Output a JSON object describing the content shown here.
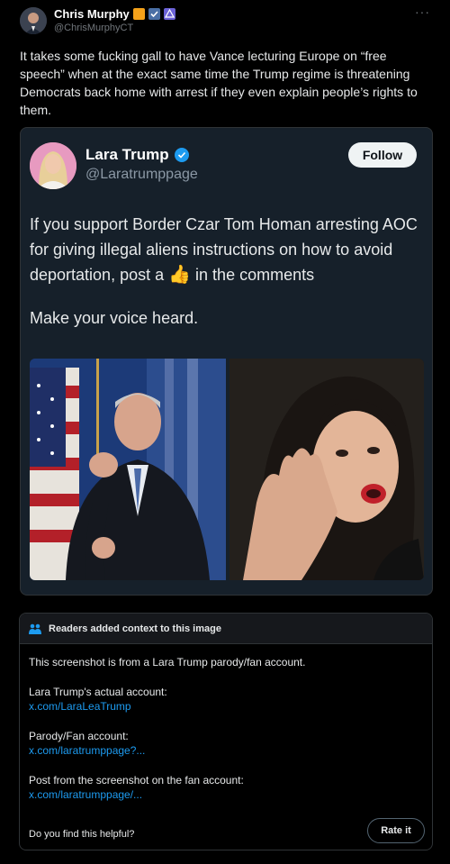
{
  "author": {
    "name": "Chris Murphy",
    "handle": "@ChrisMurphyCT"
  },
  "more_label": "···",
  "tweet_text": "It takes some fucking gall to have Vance lecturing Europe on “free speech” when at the exact same time the Trump regime is threatening Democrats back home with arrest if they even explain people’s rights to them.",
  "quoted": {
    "name": "Lara Trump",
    "handle": "@Laratrumppage",
    "follow_label": "Follow",
    "text_before_emoji": "If you support Border Czar Tom Homan arresting AOC for giving illegal aliens instructions on how to avoid deportation, post a",
    "emoji": "👍",
    "text_after_emoji": "in the comments",
    "text2": "Make your voice heard."
  },
  "context": {
    "heading": "Readers added context to this image",
    "intro": "This screenshot is from a Lara Trump parody/fan account.",
    "actual_label": "Lara Trump's actual account:",
    "actual_link": "x.com/LaraLeaTrump",
    "parody_label": "Parody/Fan account:",
    "parody_link": "x.com/laratrumppage?...",
    "post_label": "Post from the screenshot on the fan account:",
    "post_link": "x.com/laratrumppage/...",
    "helpful_question": "Do you find this helpful?",
    "rate_label": "Rate it"
  },
  "colors": {
    "background": "#000000",
    "card": "#16202a",
    "link": "#1d9bf0",
    "muted": "#71767b"
  }
}
